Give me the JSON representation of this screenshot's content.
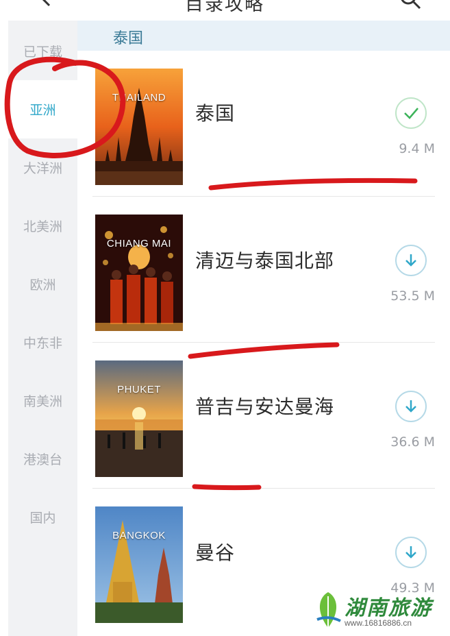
{
  "header": {
    "title": "目录攻略"
  },
  "sidebar": {
    "items": [
      {
        "label": "已下载"
      },
      {
        "label": "亚洲"
      },
      {
        "label": "大洋洲"
      },
      {
        "label": "北美洲"
      },
      {
        "label": "欧洲"
      },
      {
        "label": "中东非"
      },
      {
        "label": "南美洲"
      },
      {
        "label": "港澳台"
      },
      {
        "label": "国内"
      }
    ],
    "active_index": 1
  },
  "section": {
    "title": "泰国"
  },
  "guides": [
    {
      "name": "泰国",
      "thumb_label": "THAILAND",
      "size": "9.4 M",
      "status": "downloaded",
      "icon": "check-icon"
    },
    {
      "name": "清迈与泰国北部",
      "thumb_label": "CHIANG MAI",
      "size": "53.5 M",
      "status": "available",
      "icon": "download-arrow-icon"
    },
    {
      "name": "普吉与安达曼海",
      "thumb_label": "PHUKET",
      "size": "36.6 M",
      "status": "available",
      "icon": "download-arrow-icon"
    },
    {
      "name": "曼谷",
      "thumb_label": "BANGKOK",
      "size": "49.3 M",
      "status": "available",
      "icon": "download-arrow-icon"
    }
  ],
  "watermark": {
    "title": "湖南旅游",
    "url": "www.16816886.cn"
  },
  "colors": {
    "accent": "#2fa7c9",
    "downloaded": "#3cb35a",
    "annotation": "#d8191c",
    "section_bg": "#e8f1f8",
    "sidebar_bg": "#f1f2f4"
  }
}
